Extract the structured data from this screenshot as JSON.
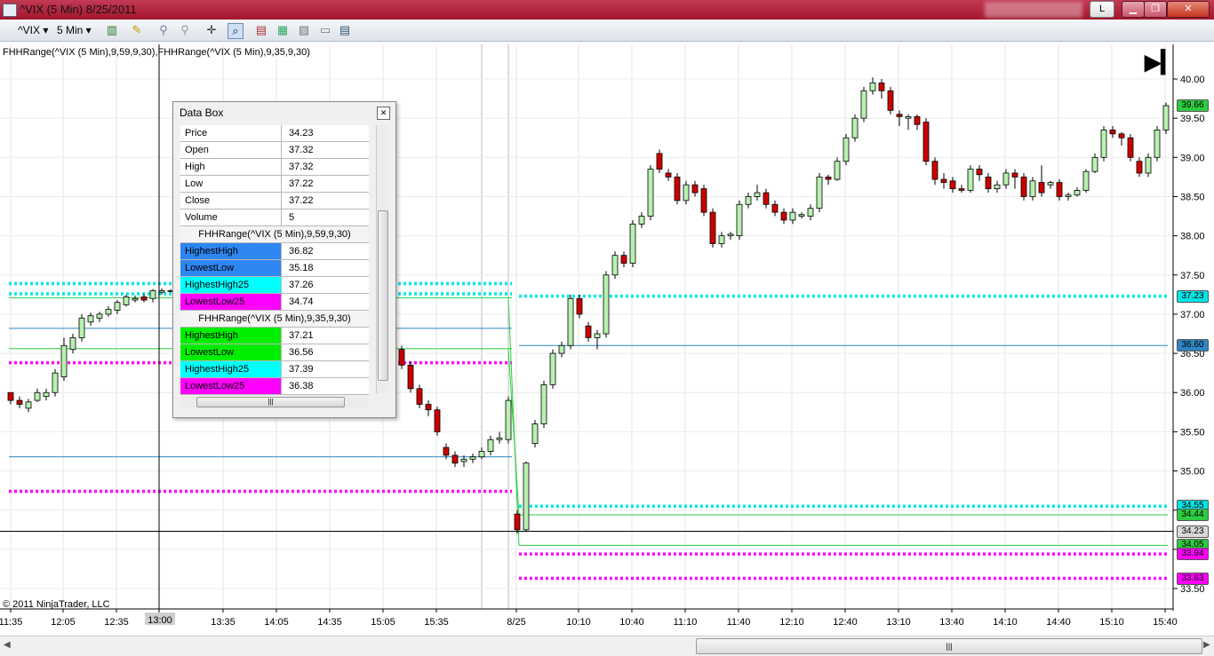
{
  "window": {
    "title": "^VIX (5 Min)  8/25/2011",
    "btn_l": "L"
  },
  "toolbar": {
    "instrument": "^VIX",
    "interval": "5 Min"
  },
  "indicator_label": "FHHRange(^VIX (5 Min),9,59,9,30),FHHRange(^VIX (5 Min),9,35,9,30)",
  "copyright": "© 2011 NinjaTrader, LLC",
  "databox": {
    "title": "Data Box",
    "rows": [
      {
        "label": "Price",
        "value": "34.23"
      },
      {
        "label": "Open",
        "value": "37.32"
      },
      {
        "label": "High",
        "value": "37.32"
      },
      {
        "label": "Low",
        "value": "37.22"
      },
      {
        "label": "Close",
        "value": "37.22"
      },
      {
        "label": "Volume",
        "value": "5"
      }
    ],
    "groups": [
      {
        "header": "FHHRange(^VIX (5 Min),9,59,9,30)",
        "rows": [
          {
            "label": "HighestHigh",
            "value": "36.82",
            "color": "#2e86f2"
          },
          {
            "label": "LowestLow",
            "value": "35.18",
            "color": "#2e86f2"
          },
          {
            "label": "HighestHigh25",
            "value": "37.26",
            "color": "#00ffff"
          },
          {
            "label": "LowestLow25",
            "value": "34.74",
            "color": "#ff00ff"
          }
        ]
      },
      {
        "header": "FHHRange(^VIX (5 Min),9,35,9,30)",
        "rows": [
          {
            "label": "HighestHigh",
            "value": "37.21",
            "color": "#00ee00"
          },
          {
            "label": "LowestLow",
            "value": "36.56",
            "color": "#00ee00"
          },
          {
            "label": "HighestHigh25",
            "value": "37.39",
            "color": "#00ffff"
          },
          {
            "label": "LowestLow25",
            "value": "36.38",
            "color": "#ff00ff"
          }
        ]
      }
    ]
  },
  "chart_data": {
    "type": "candlestick",
    "y_ticks": [
      "40.00",
      "39.50",
      "39.00",
      "38.50",
      "38.00",
      "37.50",
      "37.00",
      "36.50",
      "36.00",
      "35.50",
      "35.00",
      "34.50",
      "34.00",
      "33.50"
    ],
    "y_range": [
      33.4,
      40.3
    ],
    "x_ticks": [
      "11:35",
      "12:05",
      "12:35",
      "13:00",
      "13:35",
      "14:05",
      "14:35",
      "15:05",
      "15:35",
      "8/25",
      "10:10",
      "10:40",
      "11:10",
      "11:40",
      "12:10",
      "12:40",
      "13:10",
      "13:40",
      "14:10",
      "14:40",
      "15:10",
      "15:40"
    ],
    "crosshair": {
      "time": "13:00",
      "price": "34.23"
    },
    "price_labels": [
      {
        "text": "39.66",
        "color": "#2ecc40"
      },
      {
        "text": "37.23",
        "color": "#00e5e5"
      },
      {
        "text": "36.60",
        "color": "#2e86c1"
      },
      {
        "text": "34.55",
        "color": "#00e5e5"
      },
      {
        "text": "34.44",
        "color": "#2ecc40"
      },
      {
        "text": "34.23",
        "color": "#d8d8d8"
      },
      {
        "text": "34.05",
        "color": "#2ecc40"
      },
      {
        "text": "33.94",
        "color": "#ff00ff"
      },
      {
        "text": "33.63",
        "color": "#ff00ff"
      }
    ],
    "candles_day1": [
      [
        36.0,
        35.9,
        35.95,
        35.85
      ],
      [
        35.9,
        35.85,
        35.95,
        35.8
      ],
      [
        35.8,
        35.88,
        35.92,
        35.75
      ],
      [
        35.9,
        36.0,
        36.05,
        35.88
      ],
      [
        35.95,
        36.0,
        36.05,
        35.9
      ],
      [
        36.0,
        36.25,
        36.3,
        35.95
      ],
      [
        36.2,
        36.6,
        36.7,
        36.15
      ],
      [
        36.55,
        36.7,
        36.75,
        36.5
      ],
      [
        36.7,
        36.95,
        37.0,
        36.65
      ],
      [
        36.9,
        36.98,
        37.02,
        36.85
      ],
      [
        36.95,
        37.0,
        37.03,
        36.9
      ],
      [
        37.0,
        37.06,
        37.1,
        36.97
      ],
      [
        37.05,
        37.15,
        37.18,
        37.0
      ],
      [
        37.12,
        37.22,
        37.25,
        37.1
      ],
      [
        37.18,
        37.2,
        37.24,
        37.15
      ],
      [
        37.22,
        37.18,
        37.26,
        37.15
      ],
      [
        37.2,
        37.3,
        37.32,
        37.15
      ],
      [
        37.28,
        37.3,
        37.33,
        37.25
      ],
      [
        37.3,
        37.3,
        37.32,
        37.28
      ],
      [
        36.55,
        36.35,
        36.6,
        36.3
      ],
      [
        36.35,
        36.05,
        36.4,
        36.0
      ],
      [
        36.05,
        35.85,
        36.1,
        35.8
      ],
      [
        35.85,
        35.78,
        35.9,
        35.7
      ],
      [
        35.78,
        35.5,
        35.82,
        35.45
      ],
      [
        35.3,
        35.2,
        35.35,
        35.15
      ],
      [
        35.2,
        35.1,
        35.25,
        35.05
      ],
      [
        35.12,
        35.15,
        35.2,
        35.05
      ],
      [
        35.15,
        35.18,
        35.22,
        35.1
      ],
      [
        35.18,
        35.25,
        35.3,
        35.15
      ],
      [
        35.25,
        35.4,
        35.45,
        35.2
      ],
      [
        35.4,
        35.42,
        35.5,
        35.35
      ],
      [
        35.4,
        35.9,
        35.95,
        35.35
      ]
    ],
    "candles_day2": [
      [
        34.45,
        34.25,
        34.5,
        34.2
      ],
      [
        34.25,
        35.1,
        35.12,
        34.22
      ],
      [
        35.35,
        35.6,
        35.65,
        35.3
      ],
      [
        35.6,
        36.1,
        36.15,
        35.55
      ],
      [
        36.1,
        36.5,
        36.55,
        36.05
      ],
      [
        36.5,
        36.6,
        36.65,
        36.45
      ],
      [
        36.6,
        37.2,
        37.25,
        36.55
      ],
      [
        37.2,
        37.0,
        37.25,
        36.95
      ],
      [
        36.85,
        36.7,
        36.9,
        36.65
      ],
      [
        36.7,
        36.75,
        36.8,
        36.55
      ],
      [
        36.75,
        37.5,
        37.55,
        36.7
      ],
      [
        37.5,
        37.75,
        37.8,
        37.45
      ],
      [
        37.75,
        37.65,
        37.8,
        37.6
      ],
      [
        37.65,
        38.15,
        38.2,
        37.6
      ],
      [
        38.15,
        38.25,
        38.3,
        38.1
      ],
      [
        38.25,
        38.85,
        38.9,
        38.2
      ],
      [
        39.05,
        38.85,
        39.1,
        38.8
      ],
      [
        38.8,
        38.75,
        38.85,
        38.7
      ],
      [
        38.75,
        38.45,
        38.8,
        38.4
      ],
      [
        38.45,
        38.65,
        38.7,
        38.4
      ],
      [
        38.65,
        38.55,
        38.7,
        38.5
      ],
      [
        38.6,
        38.3,
        38.65,
        38.25
      ],
      [
        38.3,
        37.9,
        38.35,
        37.85
      ],
      [
        37.9,
        38.0,
        38.05,
        37.85
      ],
      [
        38.0,
        38.02,
        38.05,
        37.95
      ],
      [
        38.0,
        38.4,
        38.45,
        37.95
      ],
      [
        38.4,
        38.5,
        38.55,
        38.35
      ],
      [
        38.5,
        38.55,
        38.65,
        38.45
      ],
      [
        38.55,
        38.4,
        38.6,
        38.35
      ],
      [
        38.4,
        38.3,
        38.45,
        38.25
      ],
      [
        38.3,
        38.2,
        38.35,
        38.15
      ],
      [
        38.2,
        38.3,
        38.35,
        38.15
      ],
      [
        38.25,
        38.27,
        38.3,
        38.22
      ],
      [
        38.25,
        38.35,
        38.4,
        38.2
      ],
      [
        38.35,
        38.75,
        38.8,
        38.3
      ],
      [
        38.75,
        38.72,
        38.78,
        38.65
      ],
      [
        38.72,
        38.95,
        39.0,
        38.7
      ],
      [
        38.95,
        39.25,
        39.3,
        38.9
      ],
      [
        39.25,
        39.5,
        39.55,
        39.2
      ],
      [
        39.5,
        39.85,
        39.9,
        39.45
      ],
      [
        39.85,
        39.95,
        40.02,
        39.8
      ],
      [
        39.95,
        39.85,
        40.0,
        39.75
      ],
      [
        39.85,
        39.6,
        39.9,
        39.55
      ],
      [
        39.55,
        39.52,
        39.6,
        39.4
      ],
      [
        39.5,
        39.52,
        39.55,
        39.35
      ],
      [
        39.52,
        39.42,
        39.55,
        39.35
      ],
      [
        39.45,
        38.95,
        39.5,
        38.9
      ],
      [
        38.95,
        38.72,
        39.0,
        38.65
      ],
      [
        38.72,
        38.68,
        38.8,
        38.6
      ],
      [
        38.7,
        38.6,
        38.75,
        38.55
      ],
      [
        38.6,
        38.58,
        38.65,
        38.55
      ],
      [
        38.58,
        38.85,
        38.9,
        38.55
      ],
      [
        38.85,
        38.78,
        38.9,
        38.7
      ],
      [
        38.75,
        38.6,
        38.8,
        38.55
      ],
      [
        38.6,
        38.65,
        38.7,
        38.55
      ],
      [
        38.65,
        38.8,
        38.85,
        38.6
      ],
      [
        38.8,
        38.75,
        38.85,
        38.6
      ],
      [
        38.75,
        38.5,
        38.8,
        38.45
      ],
      [
        38.5,
        38.7,
        38.75,
        38.45
      ],
      [
        38.68,
        38.55,
        38.9,
        38.5
      ],
      [
        38.65,
        38.68,
        38.7,
        38.6
      ],
      [
        38.68,
        38.5,
        38.72,
        38.45
      ],
      [
        38.5,
        38.52,
        38.55,
        38.45
      ],
      [
        38.52,
        38.58,
        38.62,
        38.5
      ],
      [
        38.58,
        38.82,
        38.85,
        38.55
      ],
      [
        38.82,
        39.0,
        39.05,
        38.8
      ],
      [
        39.0,
        39.35,
        39.4,
        38.95
      ],
      [
        39.35,
        39.3,
        39.4,
        39.25
      ],
      [
        39.3,
        39.25,
        39.32,
        39.15
      ],
      [
        39.25,
        39.0,
        39.3,
        38.95
      ],
      [
        38.95,
        38.8,
        39.0,
        38.75
      ],
      [
        38.8,
        39.0,
        39.05,
        38.75
      ],
      [
        39.0,
        39.35,
        39.4,
        38.95
      ],
      [
        39.35,
        39.66,
        39.7,
        39.3
      ]
    ],
    "levels_day1": [
      {
        "price": 37.39,
        "color": "#00e5e5",
        "style": "dotted"
      },
      {
        "price": 37.26,
        "color": "#00e5e5",
        "style": "dotted"
      },
      {
        "price": 37.21,
        "color": "#2ecc40",
        "style": "solid"
      },
      {
        "price": 36.82,
        "color": "#2e86c1",
        "style": "solid"
      },
      {
        "price": 36.56,
        "color": "#2ecc40",
        "style": "solid"
      },
      {
        "price": 36.38,
        "color": "#ff00ff",
        "style": "dotted"
      },
      {
        "price": 35.18,
        "color": "#2e86c1",
        "style": "solid"
      },
      {
        "price": 34.74,
        "color": "#ff00ff",
        "style": "dotted"
      }
    ],
    "levels_day2": [
      {
        "price": 37.23,
        "color": "#00e5e5",
        "style": "dotted"
      },
      {
        "price": 36.6,
        "color": "#2e86c1",
        "style": "solid"
      },
      {
        "price": 34.55,
        "color": "#00e5e5",
        "style": "dotted"
      },
      {
        "price": 34.44,
        "color": "#2ecc40",
        "style": "solid"
      },
      {
        "price": 34.23,
        "color": "#2e86c1",
        "style": "solid"
      },
      {
        "price": 34.05,
        "color": "#2ecc40",
        "style": "solid"
      },
      {
        "price": 33.94,
        "color": "#ff00ff",
        "style": "dotted"
      },
      {
        "price": 33.63,
        "color": "#ff00ff",
        "style": "dotted"
      }
    ]
  }
}
